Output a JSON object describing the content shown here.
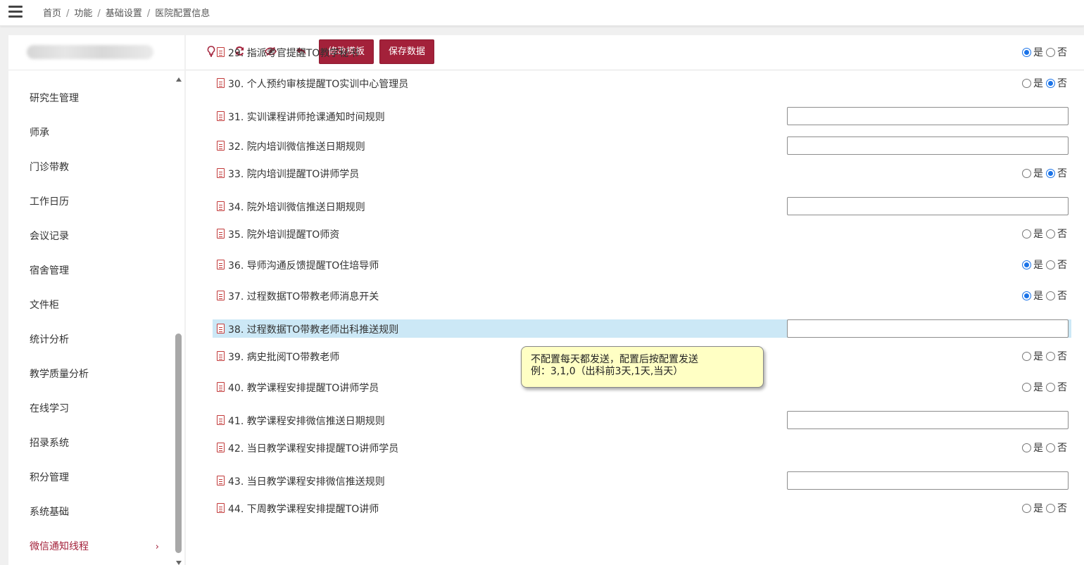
{
  "breadcrumb": {
    "items": [
      "首页",
      "功能",
      "基础设置",
      "医院配置信息"
    ]
  },
  "sidebar": {
    "items": [
      {
        "label": "研究生管理"
      },
      {
        "label": "师承"
      },
      {
        "label": "门诊带教"
      },
      {
        "label": "工作日历"
      },
      {
        "label": "会议记录"
      },
      {
        "label": "宿舍管理"
      },
      {
        "label": "文件柜"
      },
      {
        "label": "统计分析"
      },
      {
        "label": "教学质量分析"
      },
      {
        "label": "在线学习"
      },
      {
        "label": "招录系统"
      },
      {
        "label": "积分管理"
      },
      {
        "label": "系统基础"
      },
      {
        "label": "微信通知线程",
        "chevron": "›"
      }
    ]
  },
  "toolbar": {
    "icons": [
      "bulb-icon",
      "refresh-icon",
      "eye-slash-icon",
      "undo-icon"
    ],
    "edit_template_label": "修改模板",
    "save_data_label": "保存数据"
  },
  "radio_labels": {
    "yes": "是",
    "no": "否"
  },
  "config_rows": [
    {
      "label": "29. 指派考官提醒TO教学秘书",
      "type": "radio",
      "value": "yes"
    },
    {
      "label": "30. 个人预约审核提醒TO实训中心管理员",
      "type": "radio",
      "value": "no"
    },
    {
      "label": "31. 实训课程讲师抢课通知时间规则",
      "type": "text",
      "value": ""
    },
    {
      "label": "32. 院内培训微信推送日期规则",
      "type": "text",
      "value": ""
    },
    {
      "label": "33. 院内培训提醒TO讲师学员",
      "type": "radio",
      "value": "no"
    },
    {
      "label": "34. 院外培训微信推送日期规则",
      "type": "text",
      "value": ""
    },
    {
      "label": "35. 院外培训提醒TO师资",
      "type": "radio",
      "value": "none"
    },
    {
      "label": "36. 导师沟通反馈提醒TO住培导师",
      "type": "radio",
      "value": "yes"
    },
    {
      "label": "37. 过程数据TO带教老师消息开关",
      "type": "radio",
      "value": "yes"
    },
    {
      "label": "38. 过程数据TO带教老师出科推送规则",
      "type": "text",
      "value": "",
      "highlighted": true
    },
    {
      "label": "39. 病史批阅TO带教老师",
      "type": "radio",
      "value": "none"
    },
    {
      "label": "40. 教学课程安排提醒TO讲师学员",
      "type": "radio",
      "value": "none"
    },
    {
      "label": "41. 教学课程安排微信推送日期规则",
      "type": "text",
      "value": ""
    },
    {
      "label": "42. 当日教学课程安排提醒TO讲师学员",
      "type": "radio",
      "value": "none"
    },
    {
      "label": "43. 当日教学课程安排微信推送规则",
      "type": "text",
      "value": ""
    },
    {
      "label": "44. 下周教学课程安排提醒TO讲师",
      "type": "radio",
      "value": "none"
    }
  ],
  "tooltip": {
    "line1": "不配置每天都发送，配置后按配置发送",
    "line2": "例：3,1,0（出科前3天,1天,当天）"
  },
  "colors": {
    "accent": "#a3213a",
    "highlight_row": "#cce8f6",
    "tooltip_bg": "#ffffc4",
    "radio_checked": "#1a73e8"
  }
}
